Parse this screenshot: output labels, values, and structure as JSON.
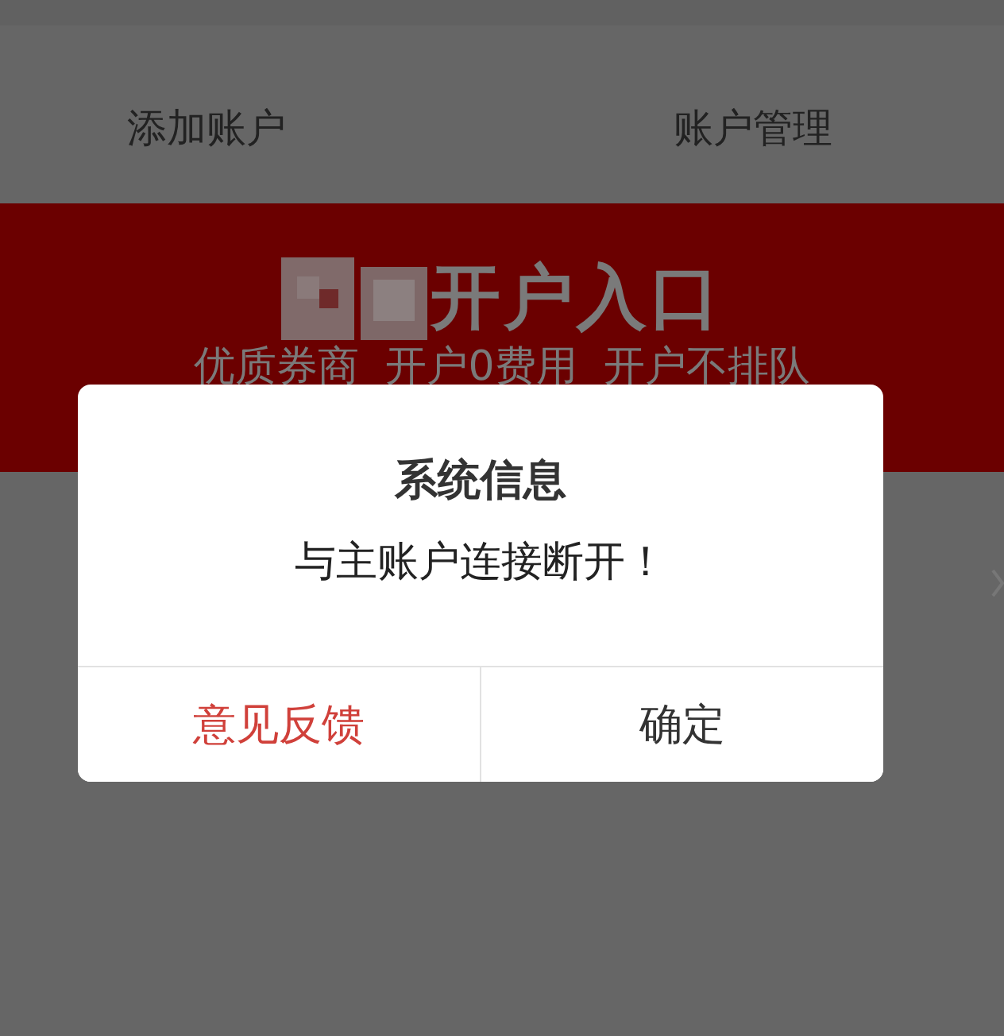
{
  "header": {
    "tabs": [
      "添加账户",
      "账户管理"
    ]
  },
  "banner": {
    "title": "开户入口",
    "subtitle": "优质券商  开户0费用  开户不排队"
  },
  "dialog": {
    "title": "系统信息",
    "message": "与主账户连接断开！",
    "buttons": [
      {
        "label": "意见反馈",
        "kind": "feedback"
      },
      {
        "label": "确定",
        "kind": "confirm"
      }
    ]
  }
}
